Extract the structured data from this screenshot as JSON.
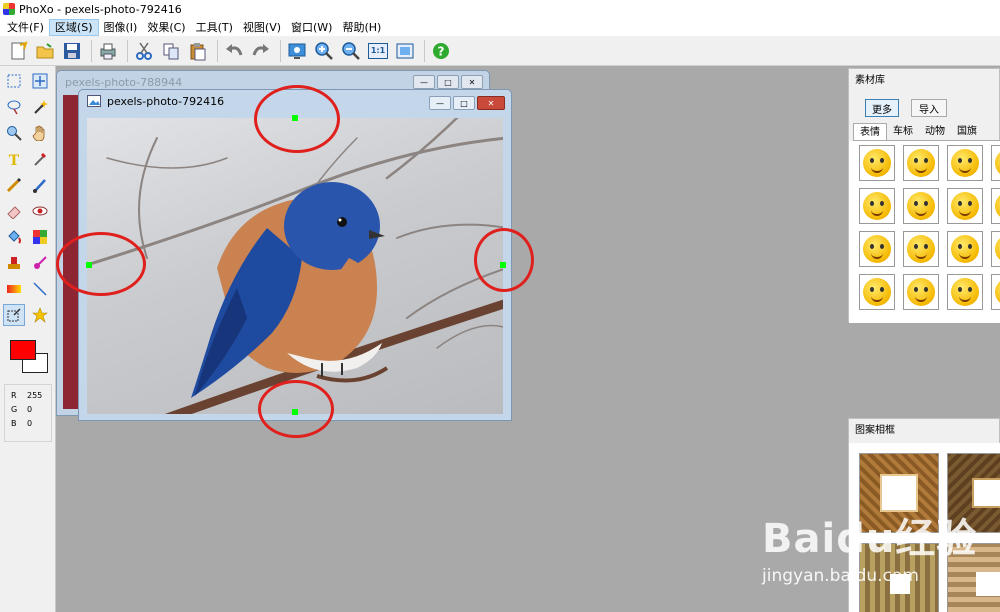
{
  "titlebar": {
    "title": "PhoXo - pexels-photo-792416"
  },
  "menu": [
    "文件(F)",
    "区域(S)",
    "图像(I)",
    "效果(C)",
    "工具(T)",
    "视图(V)",
    "窗口(W)",
    "帮助(H)"
  ],
  "toolbar": [
    "new-file-icon",
    "open-folder-icon",
    "save-icon",
    "print-icon",
    "cut-icon",
    "copy-icon",
    "paste-icon",
    "undo-icon",
    "redo-icon",
    "settings-screen-icon",
    "zoom-in-icon",
    "zoom-out-icon",
    "actual-size-icon",
    "fit-window-icon",
    "help-icon"
  ],
  "toolbar_labels": {
    "actual_size": "1:1"
  },
  "colors": {
    "foreground": "#ff0000",
    "background": "#ffffff",
    "accent": "#e0201c",
    "handle": "#00ff00"
  },
  "rgb": {
    "r_label": "R",
    "r": "255",
    "g_label": "G",
    "g": "0",
    "b_label": "B",
    "b": "0"
  },
  "windows": {
    "back_title": "pexels-photo-788944",
    "front_title": "pexels-photo-792416"
  },
  "materials": {
    "title": "素材库",
    "more": "更多",
    "import": "导入",
    "tabs": [
      "表情",
      "车标",
      "动物",
      "国旗"
    ]
  },
  "frames": {
    "title": "图案相框"
  },
  "watermark": {
    "logo": "Baidu经验",
    "url": "jingyan.baidu.com"
  }
}
